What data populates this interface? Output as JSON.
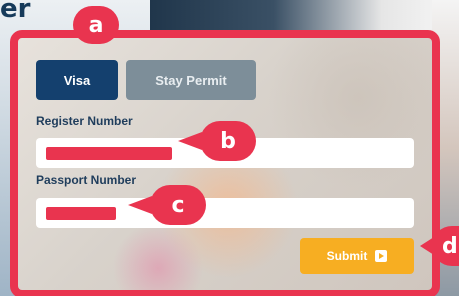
{
  "header": {
    "title_fragment": "er"
  },
  "form": {
    "tabs": [
      {
        "label": "Visa",
        "active": true
      },
      {
        "label": "Stay Permit",
        "active": false
      }
    ],
    "register_number": {
      "label": "Register Number",
      "value_redacted": true
    },
    "passport_number": {
      "label": "Passport Number",
      "value_redacted": true
    },
    "submit": {
      "label": "Submit",
      "icon": "arrow-right-box-icon"
    }
  },
  "callouts": {
    "a": "a",
    "b": "b",
    "c": "c",
    "d": "d"
  },
  "colors": {
    "highlight": "#e9344f",
    "tab_active": "#14406e",
    "tab_inactive": "#7d8e99",
    "submit": "#f7ae22",
    "label_text": "#1f3d5c"
  }
}
